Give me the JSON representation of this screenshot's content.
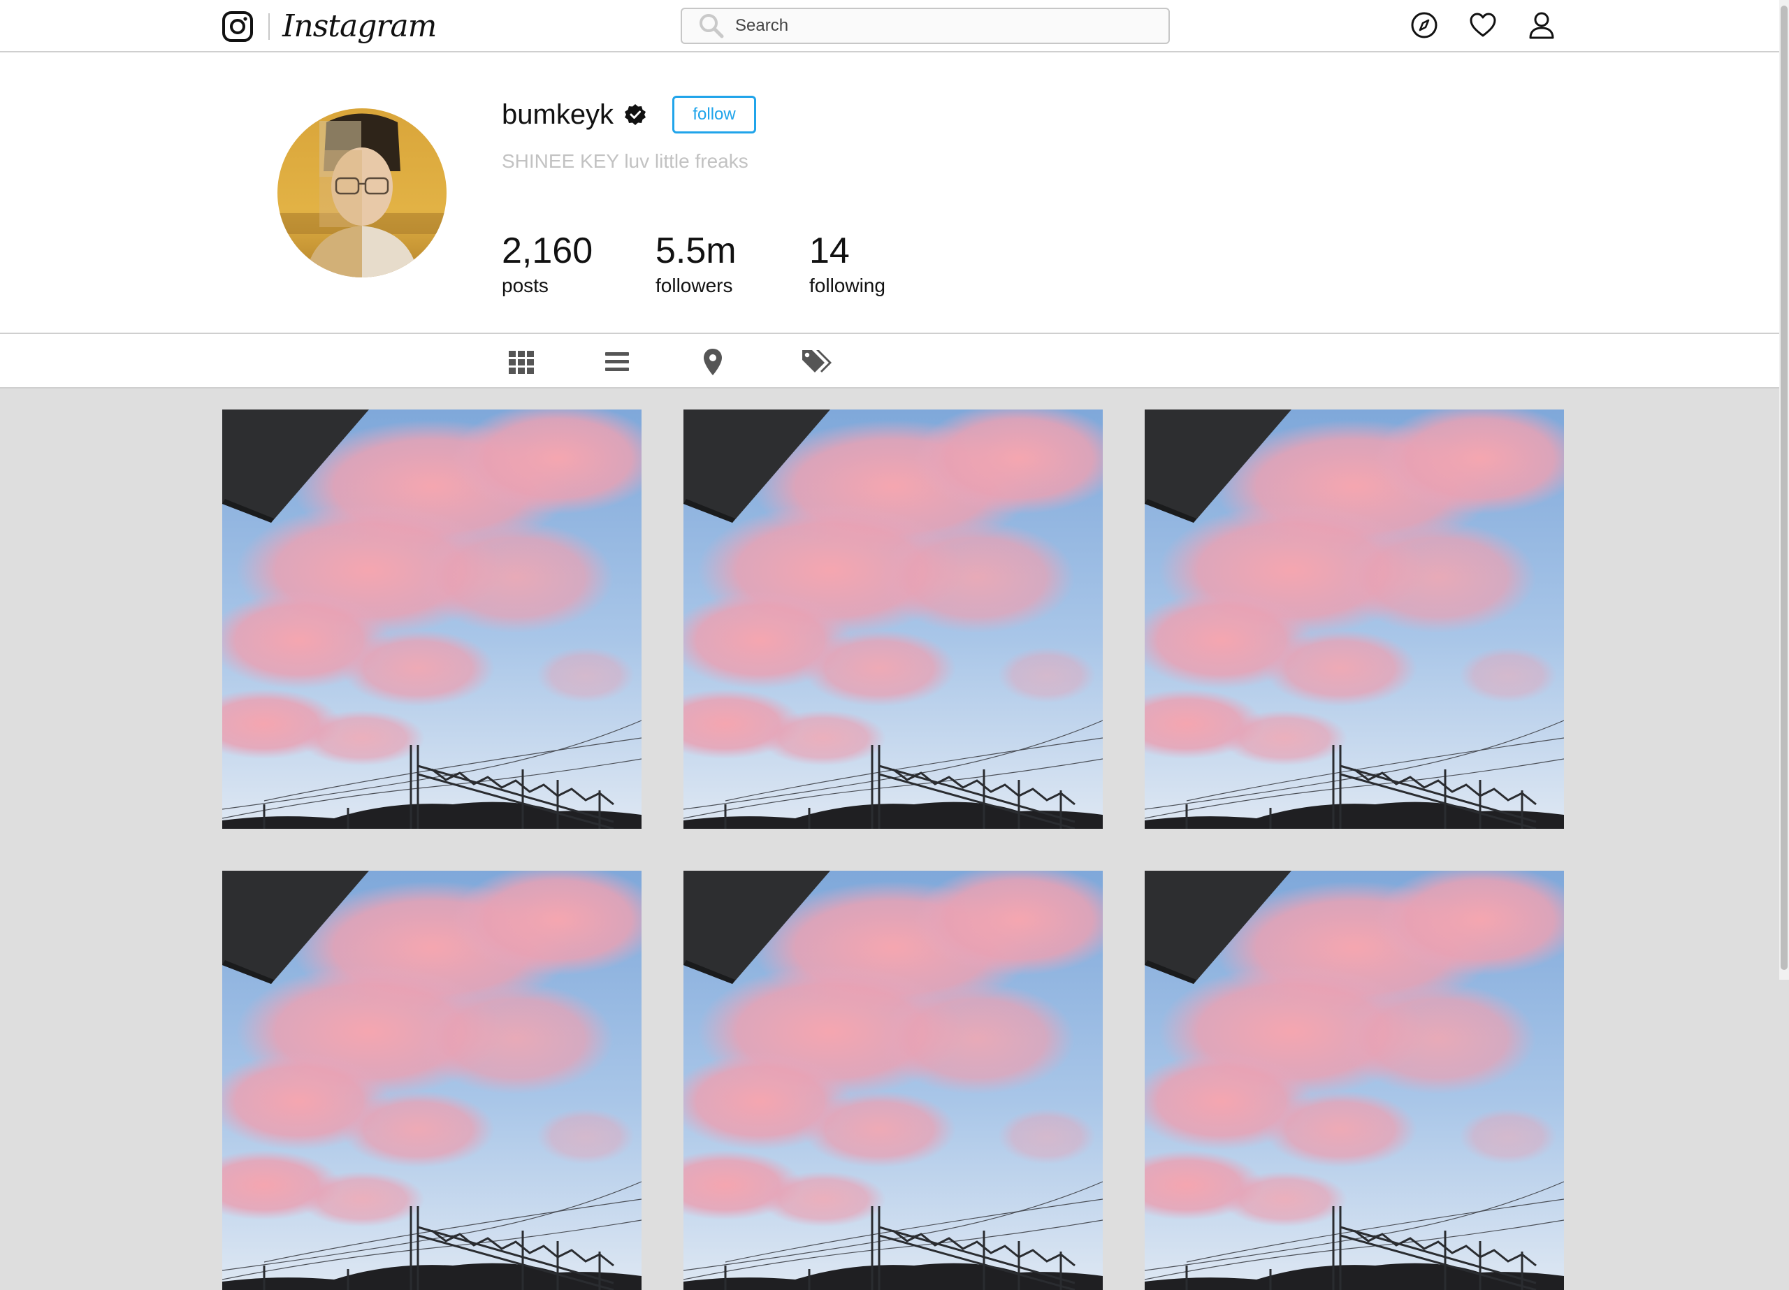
{
  "app": {
    "brand_name": "Instagram"
  },
  "nav": {
    "search_placeholder": "Search",
    "icons": [
      "explore-icon",
      "activity-heart-icon",
      "profile-icon"
    ]
  },
  "profile": {
    "username": "bumkeyk",
    "verified": true,
    "follow_label": "follow",
    "bio": "SHINEE KEY luv little freaks",
    "stats": [
      {
        "value": "2,160",
        "label": "posts"
      },
      {
        "value": "5.5m",
        "label": "followers"
      },
      {
        "value": "14",
        "label": "following"
      }
    ]
  },
  "tabs": [
    {
      "icon": "grid-icon"
    },
    {
      "icon": "list-icon"
    },
    {
      "icon": "location-pin-icon"
    },
    {
      "icon": "tags-icon"
    }
  ],
  "colors": {
    "accent": "#20a4ea",
    "bio": "#c2c2c2",
    "background": "#dedede"
  },
  "posts": [
    {
      "subject": "pink clouds over power lines"
    },
    {
      "subject": "pink clouds over power lines"
    },
    {
      "subject": "pink clouds over power lines"
    },
    {
      "subject": "pink clouds over power lines"
    },
    {
      "subject": "pink clouds over power lines"
    },
    {
      "subject": "pink clouds over power lines"
    }
  ]
}
